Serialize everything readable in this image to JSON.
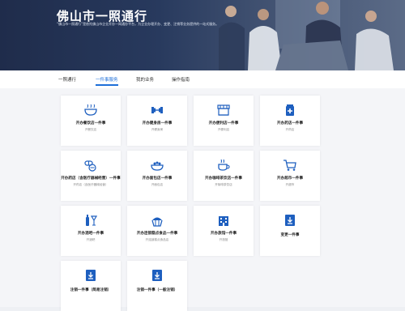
{
  "banner": {
    "title": "佛山市一照通行",
    "subtitle": "“佛山市一照通行”是依托佛山市企业开办一网通办平台，为企业办理开办、变更、注销等业务提供的一站式服务。"
  },
  "tabs": [
    {
      "label": "一照通行"
    },
    {
      "label": "一件事服务"
    },
    {
      "label": "我的业务"
    },
    {
      "label": "操作指南"
    }
  ],
  "cards": [
    {
      "title": "开办餐饮店一件事",
      "sub": "开餐饮店",
      "icon": "bowl-icon"
    },
    {
      "title": "开办健身房一件事",
      "sub": "开健身房",
      "icon": "dumbbell-icon"
    },
    {
      "title": "开办便利店一件事",
      "sub": "开便利店",
      "icon": "shop-icon"
    },
    {
      "title": "开办药店一件事",
      "sub": "开药店",
      "icon": "medicine-icon"
    },
    {
      "title": "开办药店（含医疗器械经营）一件事",
      "sub": "开药店（含医疗器械经营）",
      "icon": "pills-icon"
    },
    {
      "title": "开办面包店一件事",
      "sub": "开面包店",
      "icon": "salad-bowl-icon"
    },
    {
      "title": "开办咖啡茶饮店一件事",
      "sub": "开咖啡茶饮店",
      "icon": "coffee-icon"
    },
    {
      "title": "开办超市一件事",
      "sub": "开超市",
      "icon": "cart-icon"
    },
    {
      "title": "开办酒吧一件事",
      "sub": "开酒吧",
      "icon": "bar-icon"
    },
    {
      "title": "开办连锁糕点食品一件事",
      "sub": "开连锁糕点食品店",
      "icon": "cake-icon"
    },
    {
      "title": "开办旅馆一件事",
      "sub": "开旅馆",
      "icon": "hotel-icon"
    },
    {
      "title": "变更一件事",
      "sub": "",
      "icon": "change-icon"
    },
    {
      "title": "注销一件事（简易注销）",
      "sub": "",
      "icon": "cancel-simple-icon"
    },
    {
      "title": "注销一件事（一般注销）",
      "sub": "",
      "icon": "cancel-general-icon"
    }
  ],
  "colors": {
    "accent": "#1e6fd9",
    "banner": "#283a5e",
    "icon": "#1e5fbf"
  }
}
